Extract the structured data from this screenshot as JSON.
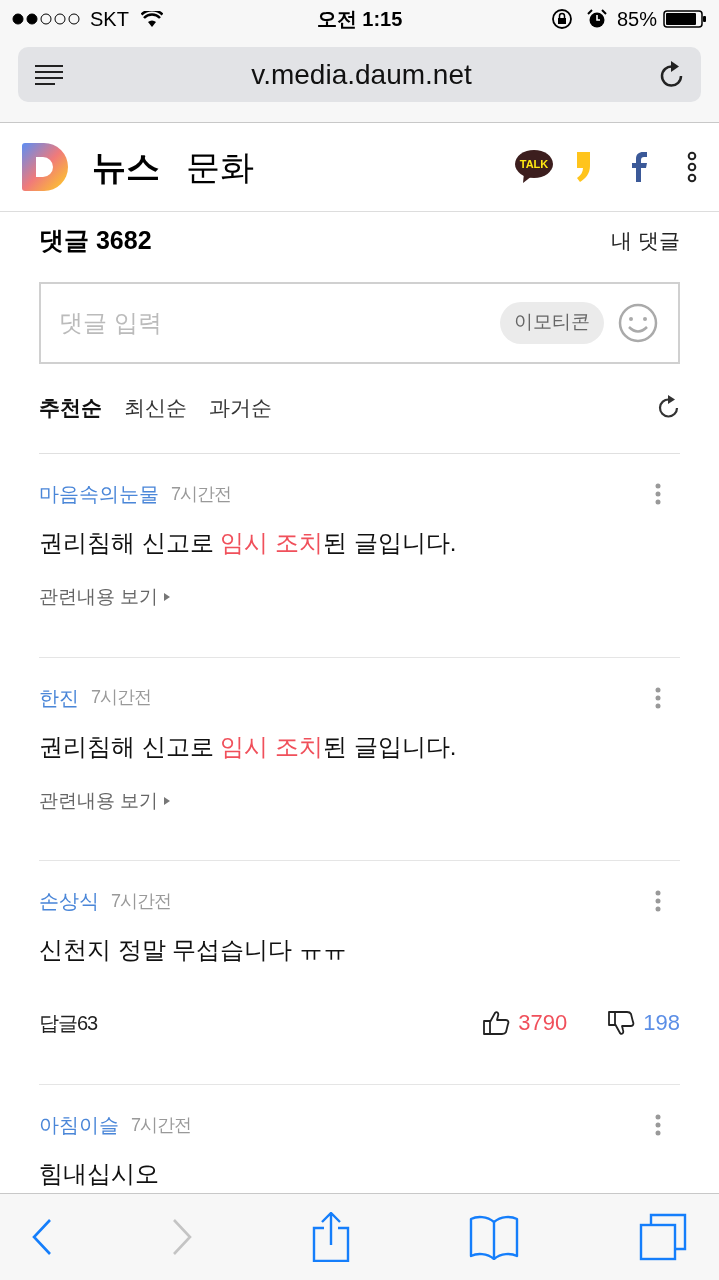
{
  "status_bar": {
    "carrier": "SKT",
    "time": "오전 1:15",
    "battery": "85%"
  },
  "address_bar": {
    "url": "v.media.daum.net"
  },
  "header": {
    "section": "뉴스",
    "category": "문화",
    "talk_label": "TALK"
  },
  "comments_header": {
    "title": "댓글 3682",
    "my_comments": "내 댓글"
  },
  "comment_input": {
    "placeholder": "댓글 입력",
    "emoticon_button": "이모티콘"
  },
  "sort_tabs": [
    {
      "label": "추천순",
      "selected": true
    },
    {
      "label": "최신순",
      "selected": false
    },
    {
      "label": "과거순",
      "selected": false
    }
  ],
  "comments": [
    {
      "kind": "blocked",
      "author": "마음속의눈물",
      "time": "7시간전",
      "body": [
        {
          "text": "권리침해 신고로 ",
          "highlight": false
        },
        {
          "text": "임시 조치",
          "highlight": true
        },
        {
          "text": "된 글입니다.",
          "highlight": false
        }
      ],
      "link": "관련내용 보기"
    },
    {
      "kind": "blocked",
      "author": "한진",
      "time": "7시간전",
      "body": [
        {
          "text": "권리침해 신고로 ",
          "highlight": false
        },
        {
          "text": "임시 조치",
          "highlight": true
        },
        {
          "text": "된 글입니다.",
          "highlight": false
        }
      ],
      "link": "관련내용 보기"
    },
    {
      "kind": "normal",
      "author": "손상식",
      "time": "7시간전",
      "body": [
        {
          "text": "신천지 정말 무섭습니다 ㅠㅠ",
          "highlight": false
        }
      ],
      "replies": "답글63",
      "likes": "3790",
      "dislikes": "198"
    },
    {
      "kind": "normal",
      "author": "아침이슬",
      "time": "7시간전",
      "body": [
        {
          "text": "힘내십시오",
          "highlight": false
        }
      ]
    }
  ]
}
